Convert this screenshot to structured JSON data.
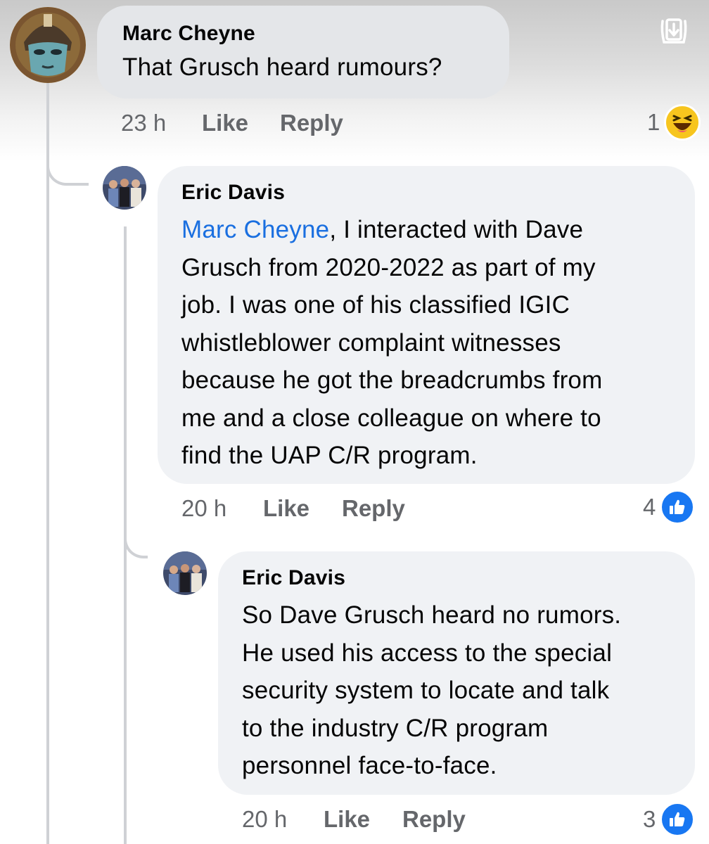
{
  "comments": [
    {
      "author": "Marc Cheyne",
      "text": "That Grusch heard rumours?",
      "time": "23 h",
      "like_label": "Like",
      "reply_label": "Reply",
      "reaction_count": "1",
      "reaction_icon": "haha-emoji-icon"
    },
    {
      "author": "Eric Davis",
      "mention": "Marc Cheyne",
      "text_lines": [
        ", I interacted with Dave",
        "Grusch from 2020-2022 as part of my",
        "job. I was one of his classified IGIC",
        "whistleblower complaint witnesses",
        "because he got the breadcrumbs from",
        "me and a close colleague on where to",
        "find the UAP C/R program."
      ],
      "time": "20 h",
      "like_label": "Like",
      "reply_label": "Reply",
      "reaction_count": "4",
      "reaction_icon": "like-thumb-icon"
    },
    {
      "author": "Eric Davis",
      "text_lines": [
        "So Dave Grusch heard no rumors.",
        "He used his access to the special",
        "security system to locate and talk",
        "to the industry C/R program",
        "personnel face-to-face."
      ],
      "time": "20 h",
      "like_label": "Like",
      "reply_label": "Reply",
      "reaction_count": "3",
      "reaction_icon": "like-thumb-icon"
    }
  ],
  "colors": {
    "bubble": "#f0f2f5",
    "meta_text": "#65676b",
    "mention": "#1a6fe0",
    "like_blue": "#1877f2",
    "haha_yellow": "#f7c51e"
  }
}
